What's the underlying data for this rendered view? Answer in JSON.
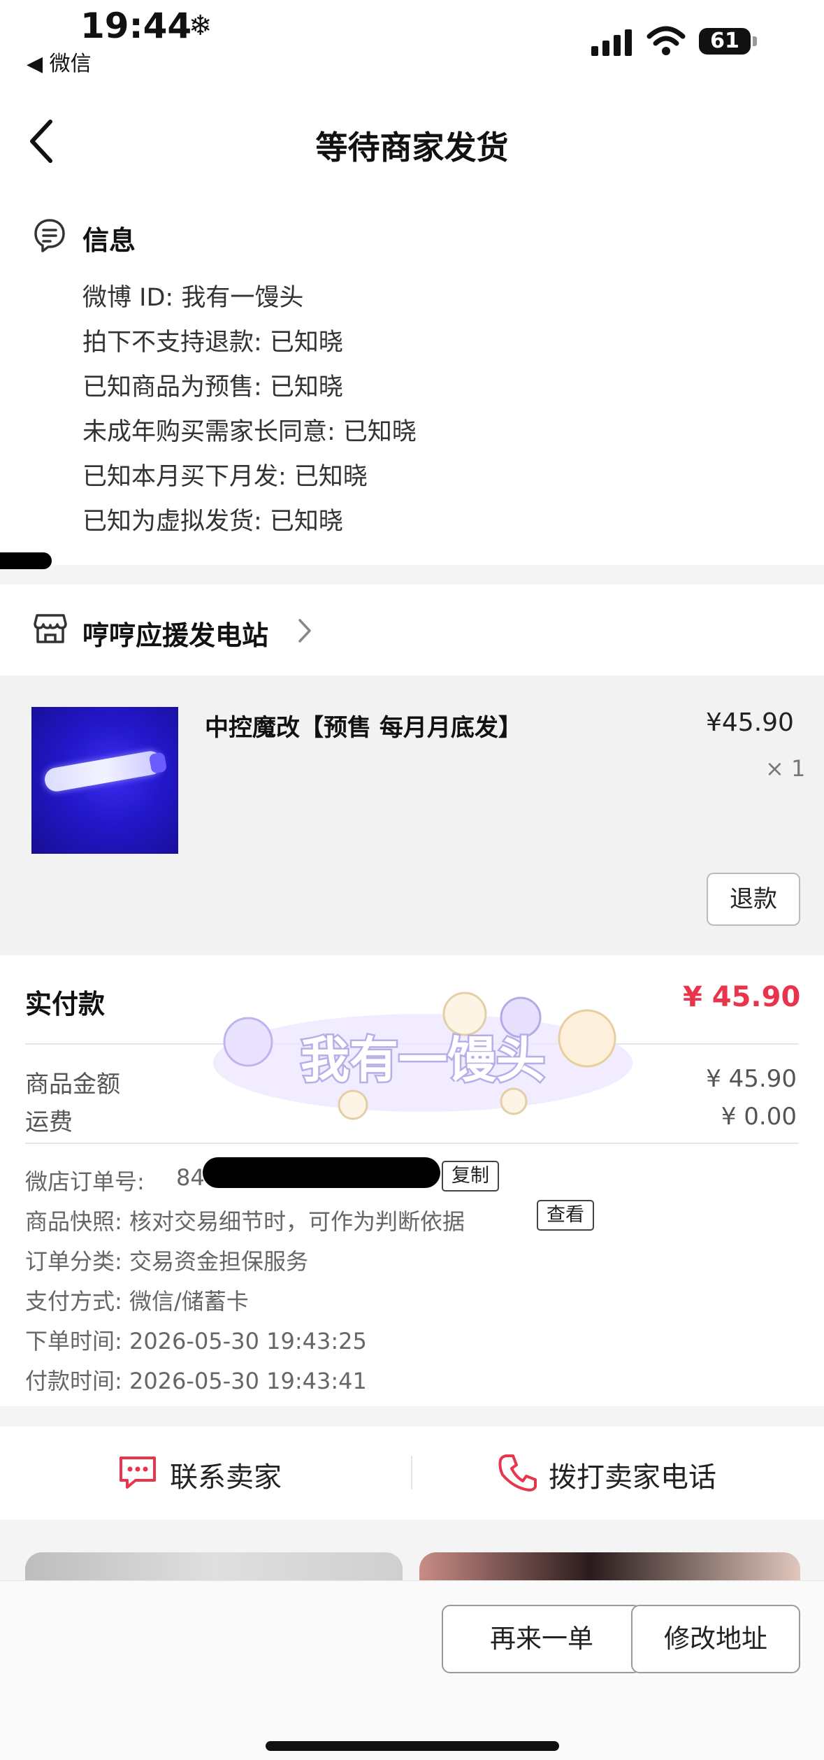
{
  "status_bar": {
    "time": "19:44",
    "time_icon": "snowflake-icon",
    "back_app": "◀ 微信",
    "battery": "61"
  },
  "nav": {
    "title": "等待商家发货",
    "back_icon": "chevron-left-icon"
  },
  "info": {
    "title": "信息",
    "lines": [
      "微博 ID: 我有一馒头",
      "拍下不支持退款: 已知晓",
      "已知商品为预售: 已知晓",
      "未成年购买需家长同意: 已知晓",
      "已知本月买下月发: 已知晓",
      "已知为虚拟发货: 已知晓"
    ]
  },
  "store": {
    "name": "哼哼应援发电站"
  },
  "product": {
    "name": "中控魔改【预售 每月月底发】",
    "price": "¥45.90",
    "qty": "× 1",
    "refund_label": "退款"
  },
  "payment": {
    "paid_label": "实付款",
    "paid_amount": "¥ 45.90",
    "goods_label": "商品金额",
    "goods_amount": "¥ 45.90",
    "shipping_label": "运费",
    "shipping_amount": "¥ 0.00",
    "watermark_text": "我有一馒头"
  },
  "order_meta": {
    "order_no_label": "微店订单号:",
    "order_no_visible": "84",
    "copy_label": "复制",
    "snapshot": "商品快照: 核对交易细节时，可作为判断依据",
    "view_label": "查看",
    "category": "订单分类:  交易资金担保服务",
    "pay_method": "支付方式:  微信/储蓄卡",
    "order_time": "下单时间:  2026-05-30 19:43:25",
    "pay_time": "付款时间:  2026-05-30 19:43:41"
  },
  "contact": {
    "seller": "联系卖家",
    "call": "拨打卖家电话"
  },
  "bottom": {
    "reorder": "再来一单",
    "edit_address": "修改地址"
  },
  "colors": {
    "accent": "#e8354c",
    "contact_icon": "#e8354c"
  }
}
